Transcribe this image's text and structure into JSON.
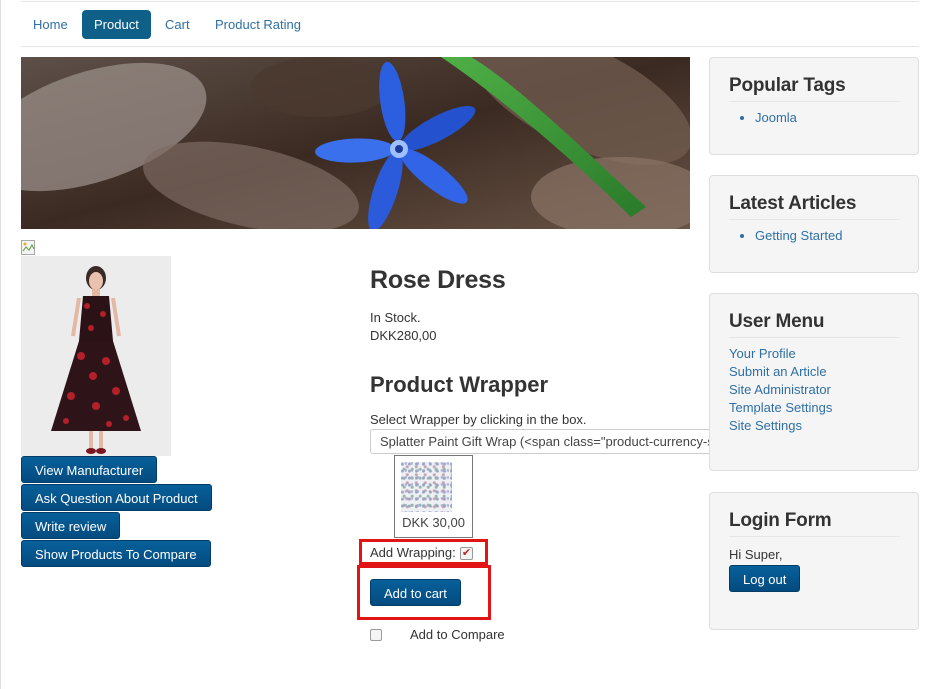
{
  "nav": {
    "tabs": [
      {
        "label": "Home"
      },
      {
        "label": "Product"
      },
      {
        "label": "Cart"
      },
      {
        "label": "Product Rating"
      }
    ]
  },
  "product": {
    "title": "Rose Dress",
    "stock": "In Stock.",
    "price": "DKK280,00",
    "buttons": {
      "view_manufacturer": "View Manufacturer",
      "ask_question": "Ask Question About Product",
      "write_review": "Write review",
      "show_compare": "Show Products To Compare"
    }
  },
  "wrapper": {
    "heading": "Product Wrapper",
    "instruction": "Select Wrapper by clicking in the box.",
    "select_value": "Splatter Paint Gift Wrap (<span class=\"product-currency-s",
    "option_price": "DKK 30,00",
    "add_wrapping_label": "Add Wrapping:",
    "add_wrapping_checked": true
  },
  "cart": {
    "add_to_cart": "Add to cart",
    "add_to_compare": "Add to Compare"
  },
  "sidebar": {
    "popular_tags": {
      "title": "Popular Tags",
      "items": [
        "Joomla"
      ]
    },
    "latest_articles": {
      "title": "Latest Articles",
      "items": [
        "Getting Started"
      ]
    },
    "user_menu": {
      "title": "User Menu",
      "items": [
        "Your Profile",
        "Submit an Article",
        "Site Administrator",
        "Template Settings",
        "Site Settings"
      ]
    },
    "login_form": {
      "title": "Login Form",
      "greeting": "Hi Super,",
      "logout": "Log out"
    }
  },
  "colors": {
    "link": "#2f6fa5",
    "nav_active": "#0f6089",
    "button": "#034b80",
    "highlight_box": "#e11515"
  }
}
